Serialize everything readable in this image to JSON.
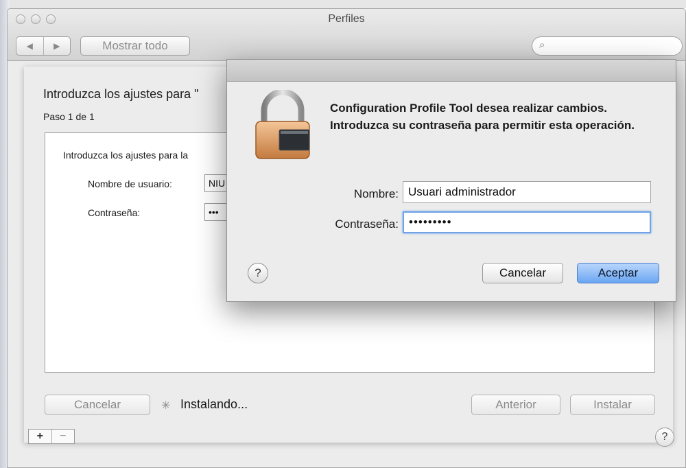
{
  "window": {
    "title": "Perfiles",
    "nav_back_icon": "◀",
    "nav_forward_icon": "▶",
    "show_all_label": "Mostrar todo",
    "search_placeholder": "",
    "search_icon": "⌕"
  },
  "pane": {
    "heading": "Introduzca los ajustes para \"",
    "step": "Paso 1 de 1",
    "intro": "Introduzca los ajustes para la",
    "username_label": "Nombre de usuario:",
    "username_value": "NIU",
    "password_label": "Contraseña:",
    "password_value": "•••",
    "cancel_label": "Cancelar",
    "status": "Instalando...",
    "previous_label": "Anterior",
    "install_label": "Instalar",
    "plus_label": "+",
    "minus_label": "−",
    "help_label": "?"
  },
  "dialog": {
    "message": "Configuration Profile Tool desea realizar cambios. Introduzca su contraseña para permitir esta operación.",
    "name_label": "Nombre:",
    "name_value": "Usuari administrador",
    "password_label": "Contraseña:",
    "password_value": "•••••••••",
    "help_label": "?",
    "cancel_label": "Cancelar",
    "ok_label": "Aceptar"
  },
  "colors": {
    "accent_button": "#6aa6f2",
    "focus_ring": "#6fa2e6"
  }
}
